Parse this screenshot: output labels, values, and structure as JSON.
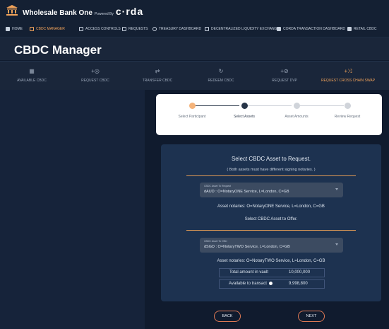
{
  "app": {
    "name": "Wholesale Bank One",
    "powered_by": "Powered By",
    "corda": "c·rda"
  },
  "nav": [
    {
      "label": "HOME",
      "icon": "home-icon",
      "active": false
    },
    {
      "label": "CBDC MANAGER",
      "icon": "wallet-icon",
      "active": true
    },
    {
      "label": "ACCESS CONTROLS",
      "icon": "lock-icon",
      "active": false
    },
    {
      "label": "REQUESTS",
      "icon": "requests-icon",
      "active": false
    },
    {
      "label": "TREASURY DASHBOARD",
      "icon": "clock-icon",
      "active": false
    },
    {
      "label": "DECENTRALIZED LIQUIDITY EXCHANGE",
      "icon": "exchange-icon",
      "active": false
    },
    {
      "label": "CORDA TRANSACTION DASHBOARD",
      "icon": "dashboard-icon",
      "active": false
    },
    {
      "label": "RETAIL CBDC",
      "icon": "retail-icon",
      "active": false
    }
  ],
  "page_title": "CBDC Manager",
  "tabs": [
    {
      "label": "AVAILABLE CBDC",
      "icon": "grid-icon",
      "active": false
    },
    {
      "label": "REQUEST CBDC",
      "icon": "request-icon",
      "active": false
    },
    {
      "label": "TRANSFER CBDC",
      "icon": "transfer-icon",
      "active": false
    },
    {
      "label": "REDEEM CBDC",
      "icon": "redeem-icon",
      "active": false
    },
    {
      "label": "REQUEST DVP",
      "icon": "dvp-icon",
      "active": false
    },
    {
      "label": "REQUEST CROSS CHAIN SWAP",
      "icon": "swap-icon",
      "active": true
    }
  ],
  "stepper": {
    "steps": [
      {
        "label": "Select Participant",
        "state": "done"
      },
      {
        "label": "Select Assets",
        "state": "current"
      },
      {
        "label": "Asset Amounts",
        "state": "todo"
      },
      {
        "label": "Review Request",
        "state": "todo"
      }
    ]
  },
  "form": {
    "heading": "Select CBDC Asset to Request.",
    "subheading": "( Both assets must have different signing notaries. )",
    "request_select": {
      "label": "CBDC Asset To Request",
      "value": "dAUD : O=NotaryONE Service, L=London, C=GB"
    },
    "request_notaries": "Asset notaries: O=NotaryONE Service, L=London, C=GB",
    "offer_heading": "Select CBDC Asset to Offer.",
    "offer_select": {
      "label": "CBDC Asset To Offer",
      "value": "dSGD : O=NotaryTWO Service, L=London, C=GB"
    },
    "offer_notaries": "Asset notaries: O=NotaryTWO Service, L=London, C=GB",
    "total_label": "Total amount in vault",
    "total_value": "10,000,000",
    "available_label": "Available to transact",
    "available_value": "9,998,800"
  },
  "buttons": {
    "back": "BACK",
    "next": "NEXT"
  },
  "colors": {
    "accent": "#f2a35a",
    "panel": "#1d3250",
    "background": "#101b2e"
  }
}
